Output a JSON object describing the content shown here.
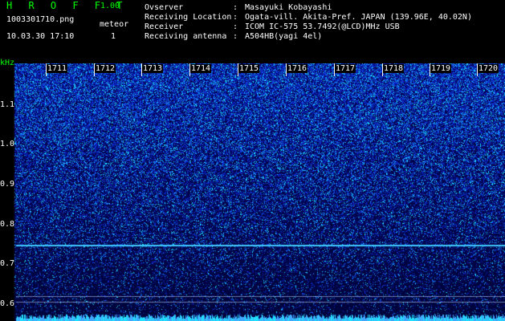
{
  "header": {
    "app_title": "H R O F F T",
    "app_version": "1.00",
    "file_name": "1003301710.png",
    "obs_type": "meteor",
    "datetime": "10.03.30 17:10",
    "count": "1"
  },
  "meta": [
    {
      "label": "Ovserver",
      "value": "Masayuki Kobayashi"
    },
    {
      "label": "Receiving Location",
      "value": "Ogata-vill. Akita-Pref. JAPAN (139.96E, 40.02N)"
    },
    {
      "label": "Receiver",
      "value": "ICOM IC-575 53.7492(@LCD)MHz USB"
    },
    {
      "label": "Receiving antenna",
      "value": "A504HB(yagi 4el)"
    }
  ],
  "meta_separator": ":",
  "spectrogram": {
    "y_unit": "kHz",
    "y_ticks": [
      "1.1",
      "1.0",
      "0.9",
      "0.8",
      "0.7",
      "0.6"
    ],
    "x_ticks": [
      "1711",
      "1712",
      "1713",
      "1714",
      "1715",
      "1716",
      "1717",
      "1718",
      "1719",
      "1720"
    ],
    "colors": {
      "background": "#000000",
      "signal_low": "#0a1aa0",
      "signal_mid": "#2860ff",
      "signal_high": "#22e0ff",
      "carrier": "#40c8ff"
    }
  }
}
